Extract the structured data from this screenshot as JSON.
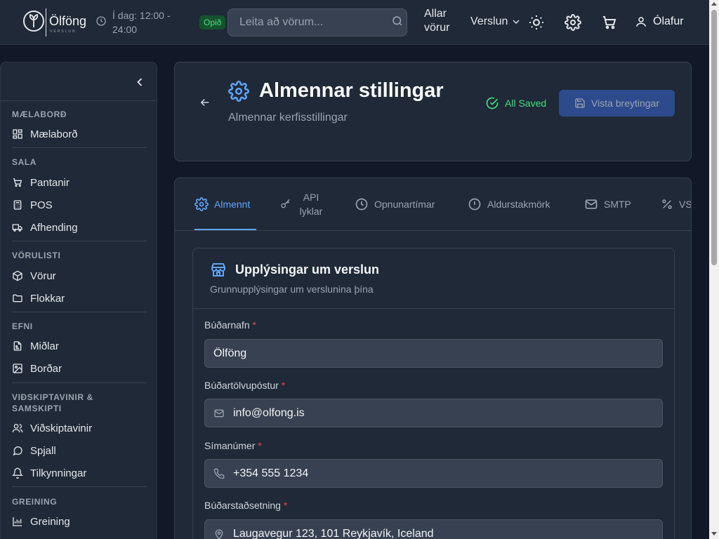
{
  "header": {
    "logo_word": "Ölföng",
    "logo_tagline": "VERSLUN",
    "hours_text": "Í dag: 12:00 - 24:00",
    "status_badge": "Opið",
    "search_placeholder": "Leita að vörum...",
    "nav_all_products": "Allar vörur",
    "nav_store": "Verslun",
    "user_name": "Ólafur"
  },
  "sidebar": {
    "sections": [
      {
        "title": "MÆLABORÐ",
        "items": [
          {
            "label": "Mælaborð",
            "icon": "dashboard-icon"
          }
        ]
      },
      {
        "title": "SALA",
        "items": [
          {
            "label": "Pantanir",
            "icon": "cart-icon"
          },
          {
            "label": "POS",
            "icon": "calculator-icon"
          },
          {
            "label": "Afhending",
            "icon": "truck-icon"
          }
        ]
      },
      {
        "title": "VÖRULISTI",
        "items": [
          {
            "label": "Vörur",
            "icon": "box-icon"
          },
          {
            "label": "Flokkar",
            "icon": "folder-icon"
          }
        ]
      },
      {
        "title": "EFNI",
        "items": [
          {
            "label": "Miðlar",
            "icon": "media-icon"
          },
          {
            "label": "Borðar",
            "icon": "image-icon"
          }
        ]
      },
      {
        "title": "VIÐSKIPTAVINIR & SAMSKIPTI",
        "items": [
          {
            "label": "Viðskiptavinir",
            "icon": "users-icon"
          },
          {
            "label": "Spjall",
            "icon": "chat-icon"
          },
          {
            "label": "Tilkynningar",
            "icon": "bell-icon"
          }
        ]
      },
      {
        "title": "GREINING",
        "items": [
          {
            "label": "Greining",
            "icon": "chart-icon"
          }
        ]
      }
    ]
  },
  "page": {
    "title": "Almennar stillingar",
    "subtitle": "Almennar kerfisstillingar",
    "saved_status": "All Saved",
    "save_button": "Vista breytingar"
  },
  "tabs": [
    {
      "label": "Almennt",
      "icon": "gear-icon",
      "active": true
    },
    {
      "label": "API lyklar",
      "icon": "key-icon",
      "active": false
    },
    {
      "label": "Opnunartímar",
      "icon": "clock-icon",
      "active": false
    },
    {
      "label": "Aldurstakmörk",
      "icon": "alert-icon",
      "active": false
    },
    {
      "label": "SMTP",
      "icon": "mail-icon",
      "active": false
    },
    {
      "label": "VSK",
      "icon": "percent-icon",
      "active": false
    }
  ],
  "store_info": {
    "title": "Upplýsingar um verslun",
    "description": "Grunnupplýsingar um verslunina þína",
    "fields": [
      {
        "label": "Búðarnafn",
        "value": "Ölföng",
        "required": "*"
      },
      {
        "label": "Búðartölvupóstur",
        "value": "info@olfong.is",
        "required": "*"
      },
      {
        "label": "Símanúmer",
        "value": "+354 555 1234",
        "required": "*"
      },
      {
        "label": "Búðarstaðsetning",
        "value": "Laugavegur 123, 101 Reykjavík, Iceland",
        "required": "*"
      }
    ]
  },
  "colors": {
    "accent": "#60a5fa",
    "success": "#4ade80",
    "required": "#ef4444",
    "background": "#111827",
    "surface": "#1f2937"
  }
}
